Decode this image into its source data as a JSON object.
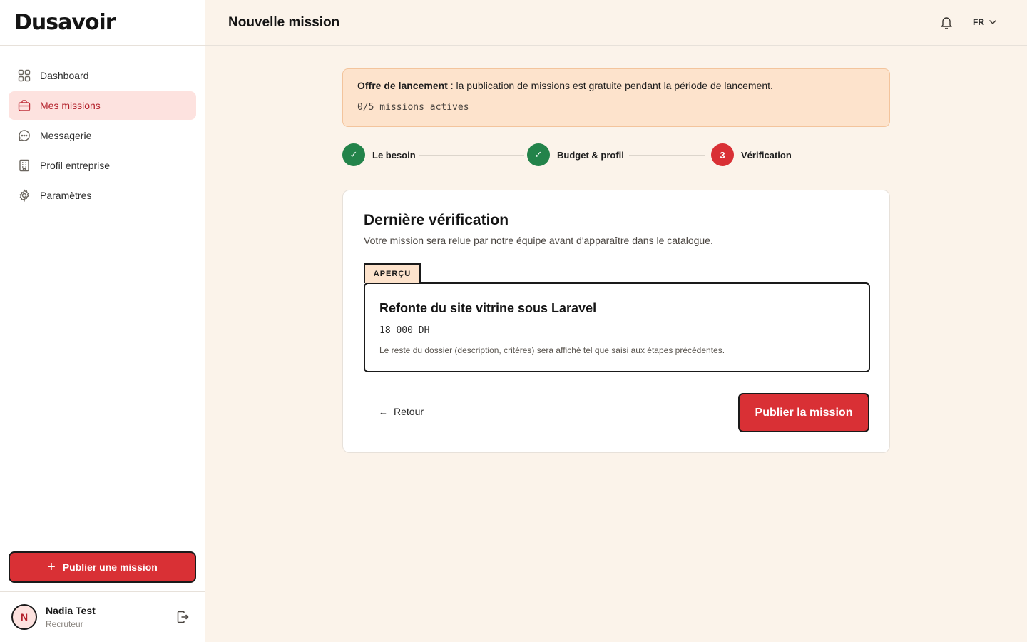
{
  "brand": {
    "name": "Dusavoir"
  },
  "sidebar": {
    "items": [
      {
        "label": "Dashboard",
        "icon": "grid-icon"
      },
      {
        "label": "Mes missions",
        "icon": "briefcase-icon",
        "active": true
      },
      {
        "label": "Messagerie",
        "icon": "chat-icon"
      },
      {
        "label": "Profil entreprise",
        "icon": "building-icon"
      },
      {
        "label": "Paramètres",
        "icon": "gear-icon"
      }
    ],
    "publish_label": "Publier une mission",
    "user": {
      "initial": "N",
      "name": "Nadia Test",
      "role": "Recruteur"
    }
  },
  "header": {
    "title": "Nouvelle mission",
    "lang": "FR"
  },
  "banner": {
    "strong": "Offre de lancement",
    "text": " : la publication de missions est gratuite pendant la période de lancement.",
    "count": "0/5 missions actives"
  },
  "stepper": {
    "steps": [
      {
        "mark": "✓",
        "label": "Le besoin",
        "state": "done"
      },
      {
        "mark": "✓",
        "label": "Budget & profil",
        "state": "done"
      },
      {
        "mark": "3",
        "label": "Vérification",
        "state": "current"
      }
    ]
  },
  "card": {
    "title": "Dernière vérification",
    "subtitle": "Votre mission sera relue par notre équipe avant d'apparaître dans le catalogue.",
    "preview_tab": "APERÇU",
    "preview": {
      "title": "Refonte du site vitrine sous Laravel",
      "budget": "18 000 DH",
      "note": "Le reste du dossier (description, critères) sera affiché tel que saisi aux étapes précédentes."
    },
    "back_label": "Retour",
    "publish_label": "Publier la mission"
  },
  "colors": {
    "accent": "#d93035",
    "accent_soft": "#fde2df",
    "success": "#23834a",
    "banner_bg": "#fde3cc",
    "page_bg": "#fbf3ea"
  }
}
